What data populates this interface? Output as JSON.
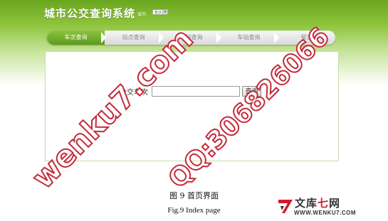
{
  "header": {
    "title": "城市公交查询系统",
    "city_label": "城市:",
    "city_value": "长沙"
  },
  "tabs": [
    {
      "label": "车次查询",
      "active": true
    },
    {
      "label": "站点查询",
      "active": false
    },
    {
      "label": "站站查询",
      "active": false
    },
    {
      "label": "车站查询",
      "active": false
    },
    {
      "label": "留言",
      "active": false
    }
  ],
  "form": {
    "route_label": "公交车次",
    "route_value": "",
    "query_button": "查询"
  },
  "watermarks": [
    "wenku7.com",
    "QQ:306826066"
  ],
  "caption": {
    "cn": "图 9  首页界面",
    "en": "Fig.9 Index page"
  },
  "logo": {
    "cn_prefix": "文库",
    "cn_highlight": "七",
    "cn_suffix": "网",
    "en": "WWW.WENKU7.COM"
  },
  "colors": {
    "brand_green": "#6aa61f",
    "tab_active": "#5d9a1c",
    "watermark_red": "#c42a3a"
  }
}
